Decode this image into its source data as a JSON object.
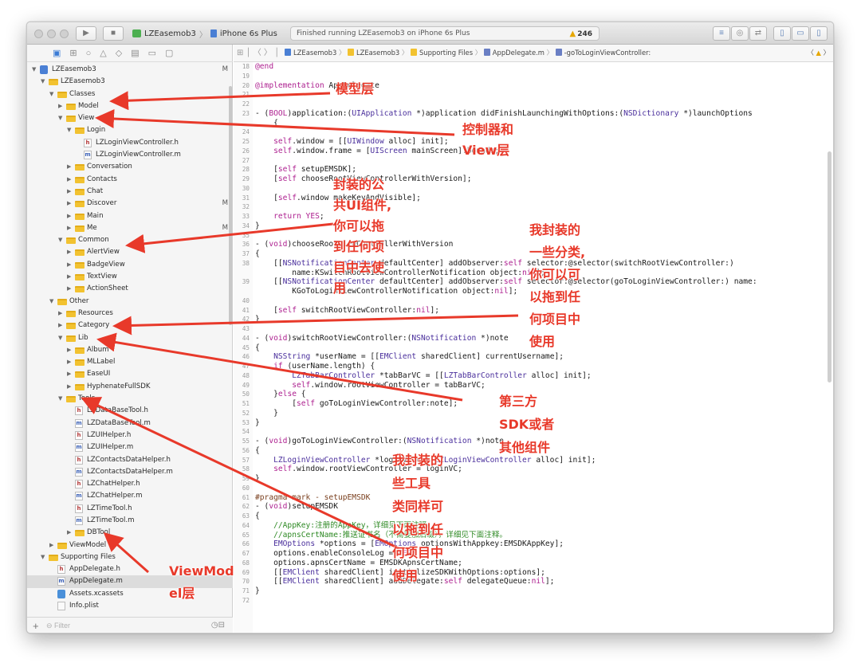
{
  "toolbar": {
    "scheme_name": "LZEasemob3",
    "device": "iPhone 6s Plus",
    "status": "Finished running LZEasemob3 on iPhone 6s Plus",
    "warning_count": "246",
    "icons": [
      "run-icon",
      "stop-icon",
      "warning-icon",
      "editor-standard-icon",
      "editor-assistant-icon",
      "editor-version-icon",
      "navigator-toggle-icon",
      "debug-toggle-icon",
      "utilities-toggle-icon"
    ]
  },
  "navigator": {
    "filter_placeholder": "Filter",
    "items": [
      {
        "label": "LZEasemob3",
        "badge": "M",
        "kind": "project"
      },
      {
        "label": "LZEasemob3",
        "badge": "",
        "kind": "folder"
      },
      {
        "label": "Classes",
        "badge": "",
        "kind": "folder"
      },
      {
        "label": "Model",
        "badge": "",
        "kind": "folder"
      },
      {
        "label": "View",
        "badge": "",
        "kind": "folder"
      },
      {
        "label": "Login",
        "badge": "",
        "kind": "folder"
      },
      {
        "label": "LZLoginViewController.h",
        "badge": "",
        "kind": "h"
      },
      {
        "label": "LZLoginViewController.m",
        "badge": "",
        "kind": "m"
      },
      {
        "label": "Conversation",
        "badge": "",
        "kind": "folder"
      },
      {
        "label": "Contacts",
        "badge": "",
        "kind": "folder"
      },
      {
        "label": "Chat",
        "badge": "",
        "kind": "folder"
      },
      {
        "label": "Discover",
        "badge": "M",
        "kind": "folder"
      },
      {
        "label": "Main",
        "badge": "",
        "kind": "folder"
      },
      {
        "label": "Me",
        "badge": "M",
        "kind": "folder"
      },
      {
        "label": "Common",
        "badge": "",
        "kind": "folder"
      },
      {
        "label": "AlertView",
        "badge": "",
        "kind": "folder"
      },
      {
        "label": "BadgeView",
        "badge": "",
        "kind": "folder"
      },
      {
        "label": "TextView",
        "badge": "",
        "kind": "folder"
      },
      {
        "label": "ActionSheet",
        "badge": "",
        "kind": "folder"
      },
      {
        "label": "Other",
        "badge": "",
        "kind": "folder"
      },
      {
        "label": "Resources",
        "badge": "",
        "kind": "folder"
      },
      {
        "label": "Category",
        "badge": "",
        "kind": "folder"
      },
      {
        "label": "Lib",
        "badge": "",
        "kind": "folder"
      },
      {
        "label": "Album",
        "badge": "",
        "kind": "folder"
      },
      {
        "label": "MLLabel",
        "badge": "",
        "kind": "folder"
      },
      {
        "label": "EaseUI",
        "badge": "",
        "kind": "folder"
      },
      {
        "label": "HyphenateFullSDK",
        "badge": "",
        "kind": "folder"
      },
      {
        "label": "Tools",
        "badge": "",
        "kind": "folder"
      },
      {
        "label": "LZDataBaseTool.h",
        "badge": "",
        "kind": "h"
      },
      {
        "label": "LZDataBaseTool.m",
        "badge": "",
        "kind": "m"
      },
      {
        "label": "LZUIHelper.h",
        "badge": "",
        "kind": "h"
      },
      {
        "label": "LZUIHelper.m",
        "badge": "",
        "kind": "m"
      },
      {
        "label": "LZContactsDataHelper.h",
        "badge": "",
        "kind": "h"
      },
      {
        "label": "LZContactsDataHelper.m",
        "badge": "",
        "kind": "m"
      },
      {
        "label": "LZChatHelper.h",
        "badge": "",
        "kind": "h"
      },
      {
        "label": "LZChatHelper.m",
        "badge": "",
        "kind": "m"
      },
      {
        "label": "LZTimeTool.h",
        "badge": "",
        "kind": "h"
      },
      {
        "label": "LZTimeTool.m",
        "badge": "",
        "kind": "m"
      },
      {
        "label": "DBTool",
        "badge": "",
        "kind": "folder"
      },
      {
        "label": "ViewModel",
        "badge": "",
        "kind": "folder"
      },
      {
        "label": "Supporting Files",
        "badge": "",
        "kind": "folder"
      },
      {
        "label": "AppDelegate.h",
        "badge": "",
        "kind": "h"
      },
      {
        "label": "AppDelegate.m",
        "badge": "",
        "kind": "m"
      },
      {
        "label": "Assets.xcassets",
        "badge": "",
        "kind": "xcassets"
      },
      {
        "label": "Info.plist",
        "badge": "",
        "kind": "plist"
      }
    ]
  },
  "jumpbar": {
    "crumbs": [
      "LZEasemob3",
      "LZEasemob3",
      "Supporting Files",
      "AppDelegate.m",
      "-goToLoginViewController:"
    ]
  },
  "editor": {
    "lines": [
      {
        "n": "18",
        "t": "@end"
      },
      {
        "n": "19",
        "t": ""
      },
      {
        "n": "20",
        "t": "@implementation AppDelegate"
      },
      {
        "n": "21",
        "t": ""
      },
      {
        "n": "22",
        "t": ""
      },
      {
        "n": "23",
        "t": "- (BOOL)application:(UIApplication *)application didFinishLaunchingWithOptions:(NSDictionary *)launchOptions"
      },
      {
        "n": "",
        "t": "    {"
      },
      {
        "n": "24",
        "t": ""
      },
      {
        "n": "25",
        "t": "    self.window = [[UIWindow alloc] init];"
      },
      {
        "n": "26",
        "t": "    self.window.frame = [UIScreen mainScreen].bounds;"
      },
      {
        "n": "27",
        "t": ""
      },
      {
        "n": "28",
        "t": "    [self setupEMSDK];"
      },
      {
        "n": "29",
        "t": "    [self chooseRootViewControllerWithVersion];"
      },
      {
        "n": "30",
        "t": ""
      },
      {
        "n": "31",
        "t": "    [self.window makeKeyAndVisible];"
      },
      {
        "n": "32",
        "t": ""
      },
      {
        "n": "33",
        "t": "    return YES;"
      },
      {
        "n": "34",
        "t": "}"
      },
      {
        "n": "35",
        "t": ""
      },
      {
        "n": "36",
        "t": "- (void)chooseRootViewControllerWithVersion"
      },
      {
        "n": "37",
        "t": "{"
      },
      {
        "n": "38",
        "t": "    [[NSNotificationCenter defaultCenter] addObserver:self selector:@selector(switchRootViewController:)"
      },
      {
        "n": "",
        "t": "        name:KSwitchRootViewControllerNotification object:nil];"
      },
      {
        "n": "39",
        "t": "    [[NSNotificationCenter defaultCenter] addObserver:self selector:@selector(goToLoginViewController:) name:"
      },
      {
        "n": "",
        "t": "        KGoToLoginViewControllerNotification object:nil];"
      },
      {
        "n": "40",
        "t": ""
      },
      {
        "n": "41",
        "t": "    [self switchRootViewController:nil];"
      },
      {
        "n": "42",
        "t": "}"
      },
      {
        "n": "43",
        "t": ""
      },
      {
        "n": "44",
        "t": "- (void)switchRootViewController:(NSNotification *)note"
      },
      {
        "n": "45",
        "t": "{"
      },
      {
        "n": "46",
        "t": "    NSString *userName = [[EMClient sharedClient] currentUsername];"
      },
      {
        "n": "47",
        "t": "    if (userName.length) {"
      },
      {
        "n": "48",
        "t": "        LZTabBarController *tabBarVC = [[LZTabBarController alloc] init];"
      },
      {
        "n": "49",
        "t": "        self.window.rootViewController = tabBarVC;"
      },
      {
        "n": "50",
        "t": "    }else {"
      },
      {
        "n": "51",
        "t": "        [self goToLoginViewController:note];"
      },
      {
        "n": "52",
        "t": "    }"
      },
      {
        "n": "53",
        "t": "}"
      },
      {
        "n": "54",
        "t": ""
      },
      {
        "n": "55",
        "t": "- (void)goToLoginViewController:(NSNotification *)note"
      },
      {
        "n": "56",
        "t": "{"
      },
      {
        "n": "57",
        "t": "    LZLoginViewController *loginVC = [[LZLoginViewController alloc] init];"
      },
      {
        "n": "58",
        "t": "    self.window.rootViewController = loginVC;"
      },
      {
        "n": "59",
        "t": "}"
      },
      {
        "n": "60",
        "t": ""
      },
      {
        "n": "61",
        "t": "#pragma mark - setupEMSDK"
      },
      {
        "n": "62",
        "t": "- (void)setupEMSDK"
      },
      {
        "n": "63",
        "t": "{"
      },
      {
        "n": "64",
        "t": "    //AppKey:注册的AppKey，详细见下面注释。"
      },
      {
        "n": "65",
        "t": "    //apnsCertName:推送证书名（不需要加后缀），详细见下面注释。"
      },
      {
        "n": "66",
        "t": "    EMOptions *options = [EMOptions optionsWithAppkey:EMSDKAppKey];"
      },
      {
        "n": "67",
        "t": "    options.enableConsoleLog = YES;"
      },
      {
        "n": "68",
        "t": "    options.apnsCertName = EMSDKApnsCertName;"
      },
      {
        "n": "69",
        "t": "    [[EMClient sharedClient] initializeSDKWithOptions:options];"
      },
      {
        "n": "70",
        "t": "    [[EMClient sharedClient] addDelegate:self delegateQueue:nil];"
      },
      {
        "n": "71",
        "t": "}"
      },
      {
        "n": "72",
        "t": ""
      }
    ]
  },
  "annotations": {
    "model_layer": "模型层",
    "controller_view": [
      "控制器和",
      "View层"
    ],
    "common_ui": [
      "封装的公",
      "共UI组件,",
      "你可以拖",
      "到任何项",
      "目中去使",
      "用"
    ],
    "category": [
      "我封装的",
      "一些分类,",
      "你可以可",
      "以拖到任",
      "何项目中",
      "使用"
    ],
    "third_party": [
      "第三方",
      "SDK或者",
      "其他组件"
    ],
    "tools": [
      "我封装的",
      "些工具",
      "类同样可",
      "以拖到任",
      "何项目中",
      "使用"
    ],
    "viewmodel": [
      "ViewMod",
      "el层"
    ],
    "arrow_color": "#e8392a"
  }
}
